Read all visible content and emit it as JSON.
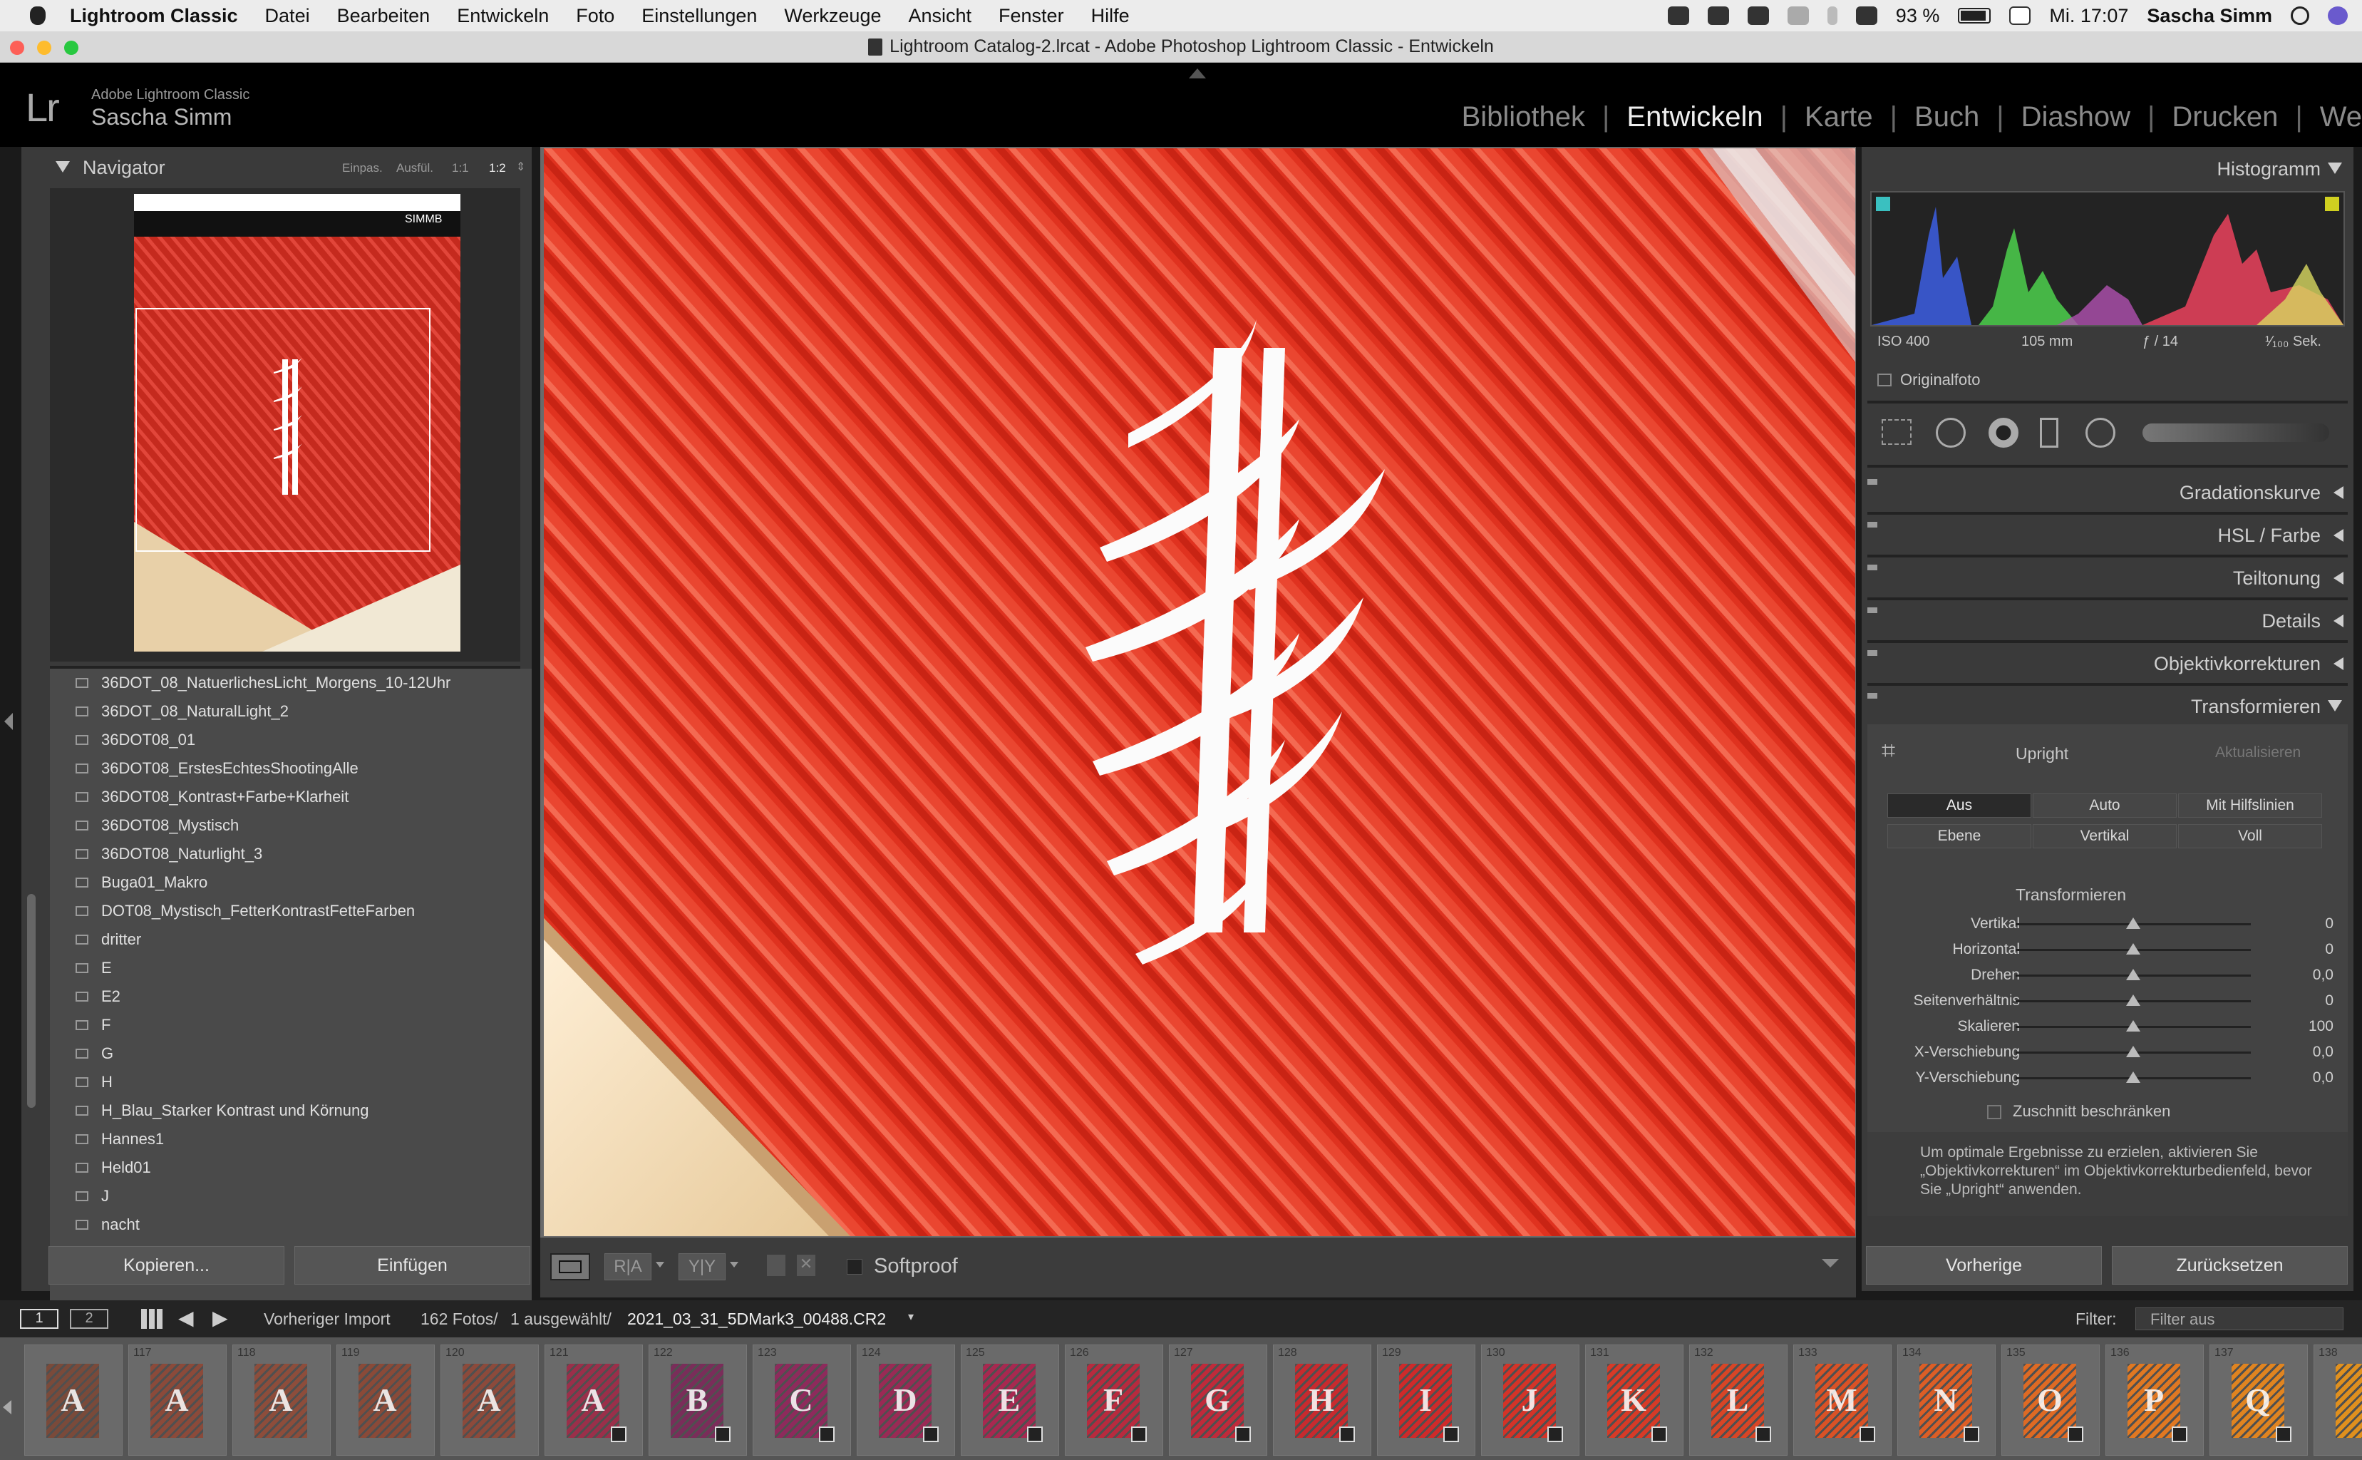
{
  "menubar": {
    "app": "Lightroom Classic",
    "items": [
      "Datei",
      "Bearbeiten",
      "Entwickeln",
      "Foto",
      "Einstellungen",
      "Werkzeuge",
      "Ansicht",
      "Fenster",
      "Hilfe"
    ],
    "battery": "93 %",
    "clock": "Mi. 17:07",
    "user": "Sascha Simm"
  },
  "window": {
    "title": "Lightroom Catalog-2.lrcat - Adobe Photoshop Lightroom Classic - Entwickeln"
  },
  "identity": {
    "logo": "Lr",
    "app": "Adobe Lightroom Classic",
    "user": "Sascha Simm"
  },
  "modules": [
    {
      "label": "Bibliothek"
    },
    {
      "label": "Entwickeln",
      "active": true
    },
    {
      "label": "Karte"
    },
    {
      "label": "Buch"
    },
    {
      "label": "Diashow"
    },
    {
      "label": "Drucken"
    },
    {
      "label": "We"
    }
  ],
  "navigator": {
    "title": "Navigator",
    "zoom_fit": "Einpas.",
    "zoom_fill": "Ausfül.",
    "zoom_1": "1:1",
    "zoom_2": "1:2"
  },
  "presets": [
    "36DOT_08_NatuerlichesLicht_Morgens_10-12Uhr",
    "36DOT_08_NaturalLight_2",
    "36DOT08_01",
    "36DOT08_ErstesEchtesShootingAlle",
    "36DOT08_Kontrast+Farbe+Klarheit",
    "36DOT08_Mystisch",
    "36DOT08_Naturlight_3",
    "Buga01_Makro",
    "DOT08_Mystisch_FetterKontrastFetteFarben",
    "dritter",
    "E",
    "E2",
    "F",
    "G",
    "H",
    "H_Blau_Starker Kontrast und Körnung",
    "Hannes1",
    "Held01",
    "J",
    "nacht"
  ],
  "left_buttons": {
    "copy": "Kopieren...",
    "paste": "Einfügen"
  },
  "toolbar": {
    "softproof": "Softproof"
  },
  "right": {
    "histogram_title": "Histogramm",
    "exif": {
      "iso": "ISO 400",
      "focal": "105 mm",
      "aperture": "ƒ / 14",
      "shutter": "¹⁄₁₀₀ Sek."
    },
    "original": "Originalfoto",
    "sections": [
      "Gradationskurve",
      "HSL / Farbe",
      "Teiltonung",
      "Details",
      "Objektivkorrekturen",
      "Transformieren"
    ],
    "upright": {
      "title": "Upright",
      "update": "Aktualisieren",
      "buttons": [
        "Aus",
        "Auto",
        "Mit Hilfslinien",
        "Ebene",
        "Vertikal",
        "Voll"
      ]
    },
    "transform": {
      "title": "Transformieren",
      "sliders": [
        {
          "label": "Vertikal",
          "value": "0",
          "pos": 0.5
        },
        {
          "label": "Horizontal",
          "value": "0",
          "pos": 0.5
        },
        {
          "label": "Drehen",
          "value": "0,0",
          "pos": 0.5
        },
        {
          "label": "Seitenverhältnis",
          "value": "0",
          "pos": 0.5
        },
        {
          "label": "Skalieren",
          "value": "100",
          "pos": 0.5
        },
        {
          "label": "X-Verschiebung",
          "value": "0,0",
          "pos": 0.5
        },
        {
          "label": "Y-Verschiebung",
          "value": "0,0",
          "pos": 0.5
        }
      ],
      "constrain": "Zuschnitt beschränken",
      "hint": "Um optimale Ergebnisse zu erzielen, aktivieren Sie „Objektivkorrekturen“ im Objektivkorrekturbedienfeld, bevor Sie „Upright“ anwenden."
    },
    "prev_btn": "Vorherige",
    "reset_btn": "Zurücksetzen"
  },
  "filmstrip": {
    "screen1": "1",
    "screen2": "2",
    "source": "Vorheriger Import",
    "count": "162 Fotos/",
    "selected": "1 ausgewählt/",
    "filename": "2021_03_31_5DMark3_00488.CR2",
    "filter_label": "Filter:",
    "filter_value": "Filter aus",
    "thumbs": [
      {
        "idx": "",
        "letter": "A",
        "color": "#7a4a3a"
      },
      {
        "idx": "117",
        "letter": "A",
        "color": "#8b4a3a"
      },
      {
        "idx": "118",
        "letter": "A",
        "color": "#8d4d3b"
      },
      {
        "idx": "119",
        "letter": "A",
        "color": "#8a4a38"
      },
      {
        "idx": "120",
        "letter": "A",
        "color": "#8c4a3b"
      },
      {
        "idx": "121",
        "letter": "A",
        "color": "#9b2f4a"
      },
      {
        "idx": "122",
        "letter": "B",
        "color": "#7a2d5a"
      },
      {
        "idx": "123",
        "letter": "C",
        "color": "#8e2a5c"
      },
      {
        "idx": "124",
        "letter": "D",
        "color": "#9a2a55"
      },
      {
        "idx": "125",
        "letter": "E",
        "color": "#a82850"
      },
      {
        "idx": "126",
        "letter": "F",
        "color": "#b82a3e"
      },
      {
        "idx": "127",
        "letter": "G",
        "color": "#c02a3a"
      },
      {
        "idx": "128",
        "letter": "H",
        "color": "#c82a2e"
      },
      {
        "idx": "129",
        "letter": "I",
        "color": "#cf2a2a"
      },
      {
        "idx": "130",
        "letter": "J",
        "color": "#d43328"
      },
      {
        "idx": "131",
        "letter": "K",
        "color": "#d73a27"
      },
      {
        "idx": "132",
        "letter": "L",
        "color": "#d84526"
      },
      {
        "idx": "133",
        "letter": "M",
        "color": "#da5226"
      },
      {
        "idx": "134",
        "letter": "N",
        "color": "#dc5e26"
      },
      {
        "idx": "135",
        "letter": "O",
        "color": "#de6a24"
      },
      {
        "idx": "136",
        "letter": "P",
        "color": "#e07822"
      },
      {
        "idx": "137",
        "letter": "Q",
        "color": "#e08420"
      },
      {
        "idx": "138",
        "letter": "",
        "color": "#e0901e"
      }
    ]
  }
}
